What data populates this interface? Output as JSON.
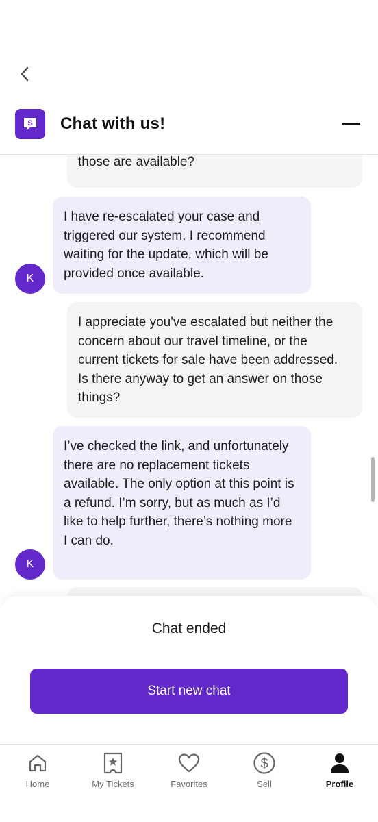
{
  "header": {
    "title": "Chat with us!",
    "brand_color": "#6228c9"
  },
  "messages": [
    {
      "sender": "user",
      "text": "those are available?"
    },
    {
      "sender": "agent",
      "avatar": "K",
      "text": "I have re-escalated your case and triggered our system. I recommend waiting for the update, which will be provided once available."
    },
    {
      "sender": "user",
      "text": "I appreciate you've escalated but neither the concern about our travel timeline, or the current tickets for sale have been addressed. Is there anyway to get an answer on those things?"
    },
    {
      "sender": "agent",
      "avatar": "K",
      "text": "I’ve checked the link, and unfortunately there are no replacement tickets available. The only option at this point is a refund. I’m sorry, but as much as I’d like to help further, there’s nothing more I can do."
    }
  ],
  "footer": {
    "status": "Chat ended",
    "start_button": "Start new chat"
  },
  "nav": {
    "items": [
      {
        "label": "Home",
        "icon": "home-icon"
      },
      {
        "label": "My Tickets",
        "icon": "ticket-icon"
      },
      {
        "label": "Favorites",
        "icon": "heart-icon"
      },
      {
        "label": "Sell",
        "icon": "dollar-icon"
      },
      {
        "label": "Profile",
        "icon": "person-icon",
        "active": true
      }
    ]
  }
}
